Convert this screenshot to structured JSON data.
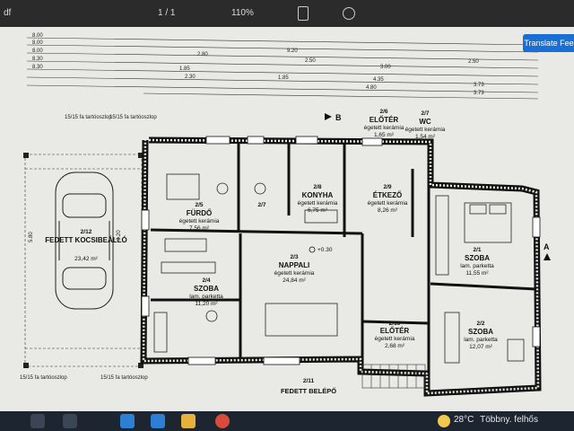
{
  "toolbar": {
    "left_label": "df",
    "page_label": "1 / 1",
    "zoom": "110%",
    "translate_button": "Translate Feel"
  },
  "plan": {
    "dims_top": [
      "8.00",
      "8.00",
      "8.00",
      "8.30",
      "8.30",
      "1.85",
      "2.30",
      "1.85",
      "9.20",
      "2.50",
      "3.00",
      "2.50",
      "4.35",
      "4.80",
      "3.73",
      "3.73",
      "2.80",
      "5.80",
      "3.20"
    ],
    "section_marker": "B",
    "elevation": "+0.30",
    "side_marker": "A",
    "column_label_1": "15/15 fa tartóoszlop",
    "column_label_2": "15/15 fa tartóoszlop",
    "column_label_3": "15/15 fa tartóoszlop",
    "column_label_4": "15/15 fa tartóoszlop",
    "rooms": [
      {
        "num": "2/12",
        "name": "FEDETT KOCSIBEÁLLÓ",
        "area": "23,42 m²"
      },
      {
        "num": "2/5",
        "name": "FÜRDŐ",
        "floor": "égetett kerámia",
        "area": "7,56 m²"
      },
      {
        "num": "2/7",
        "name": "",
        "floor": "",
        "area": ""
      },
      {
        "num": "2/8",
        "name": "KONYHA",
        "floor": "égetett kerámia",
        "area": "6,75 m²"
      },
      {
        "num": "2/9",
        "name": "ÉTKEZŐ",
        "floor": "égetett kerámia",
        "area": "8,26 m²"
      },
      {
        "num": "2/6",
        "name": "ELŐTÉR",
        "floor": "égetett kerámia",
        "area": "1,65 m²"
      },
      {
        "num": "2/7",
        "name": "WC",
        "floor": "égetett kerámia",
        "area": "1,54 m²"
      },
      {
        "num": "2/4",
        "name": "SZOBA",
        "floor": "lam. parketta",
        "area": "11,20 m²"
      },
      {
        "num": "2/3",
        "name": "NAPPALI",
        "floor": "égetett kerámia",
        "area": "24,84 m²"
      },
      {
        "num": "2/10",
        "name": "ELŐTÉR",
        "floor": "égetett kerámia",
        "area": "2,68 m²"
      },
      {
        "num": "2/1",
        "name": "SZOBA",
        "floor": "lam. parketta",
        "area": "11,55 m²"
      },
      {
        "num": "2/2",
        "name": "SZOBA",
        "floor": "lam. parketta",
        "area": "12,07 m²"
      },
      {
        "num": "2/11",
        "name": "FEDETT BELÉPŐ",
        "floor": "",
        "area": ""
      }
    ]
  },
  "taskbar": {
    "temperature": "28°C",
    "weather": "Többny. felhős"
  }
}
